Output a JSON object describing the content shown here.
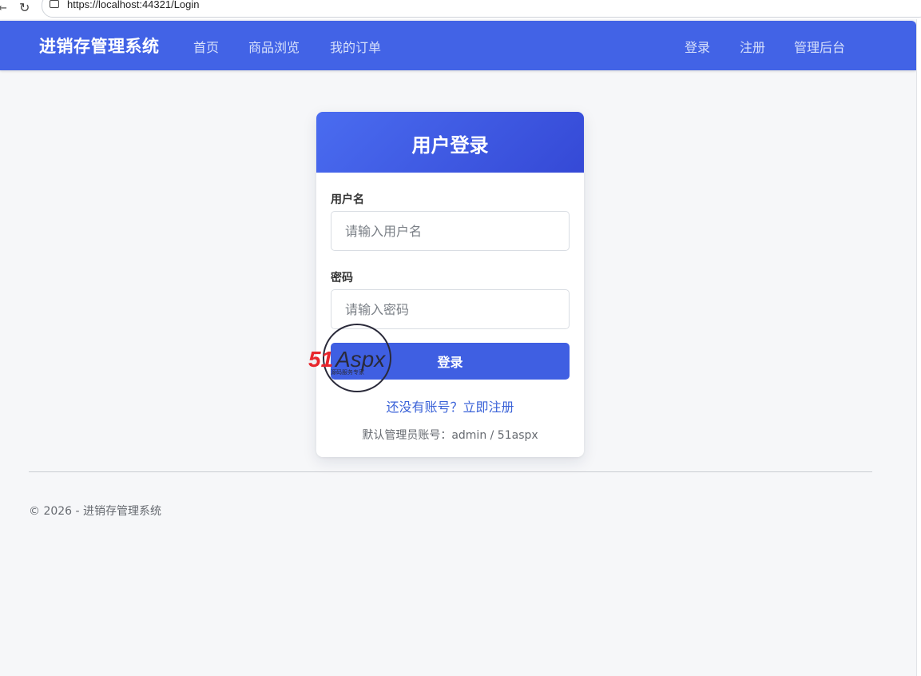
{
  "browser": {
    "url": "https://localhost:44321/Login",
    "back_glyph": "←",
    "reload_glyph": "↻"
  },
  "navbar": {
    "brand": "进销存管理系统",
    "links": [
      {
        "label": "首页"
      },
      {
        "label": "商品浏览"
      },
      {
        "label": "我的订单"
      }
    ],
    "right_links": [
      {
        "label": "登录"
      },
      {
        "label": "注册"
      },
      {
        "label": "管理后台"
      }
    ],
    "accent_color": "#4263e6"
  },
  "login_card": {
    "title": "用户登录",
    "username_label": "用户名",
    "username_placeholder": "请输入用户名",
    "username_value": "",
    "password_label": "密码",
    "password_placeholder": "请输入密码",
    "password_value": "",
    "submit_label": "登录",
    "register_link": "还没有账号？立即注册",
    "default_account_hint": "默认管理员账号：admin / 51aspx"
  },
  "watermark": {
    "text": "51Aspx",
    "subtext": "源码服务专家",
    "colors": {
      "red": "#e8262c",
      "dark": "#2a2a3a",
      "green": "#3aa64a"
    }
  },
  "footer": {
    "text": "© 2026 - 进销存管理系统"
  }
}
